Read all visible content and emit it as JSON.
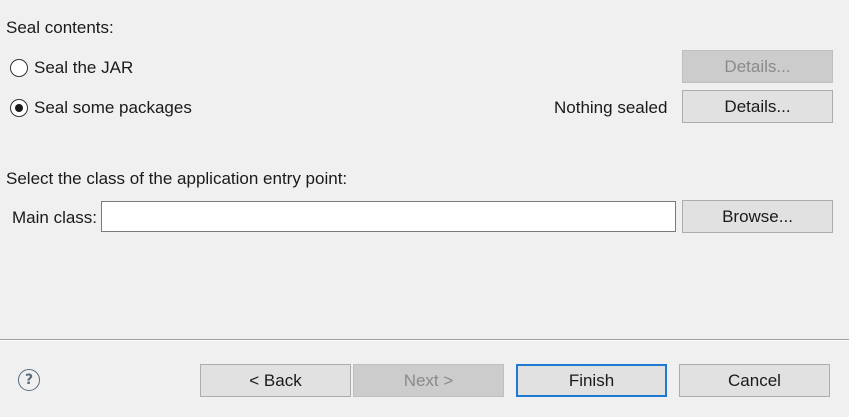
{
  "sealing": {
    "heading": "Seal contents:",
    "options": [
      {
        "label": "Seal the JAR",
        "selected": false,
        "details_label": "Details...",
        "details_enabled": false
      },
      {
        "label": "Seal some packages",
        "selected": true,
        "details_label": "Details...",
        "details_enabled": true,
        "status": "Nothing sealed"
      }
    ]
  },
  "entry_point": {
    "heading": "Select the class of the application entry point:",
    "main_class_label": "Main class:",
    "main_class_value": "",
    "browse_label": "Browse..."
  },
  "footer": {
    "help_glyph": "?",
    "help_icon": "help-icon",
    "back_label": "< Back",
    "next_label": "Next >",
    "next_enabled": false,
    "finish_label": "Finish",
    "finish_is_default": true,
    "cancel_label": "Cancel"
  },
  "colors": {
    "background": "#f0f0f0",
    "button_face": "#e1e1e1",
    "disabled_button_face": "#cccccc",
    "default_button_border": "#1c7bd1"
  }
}
